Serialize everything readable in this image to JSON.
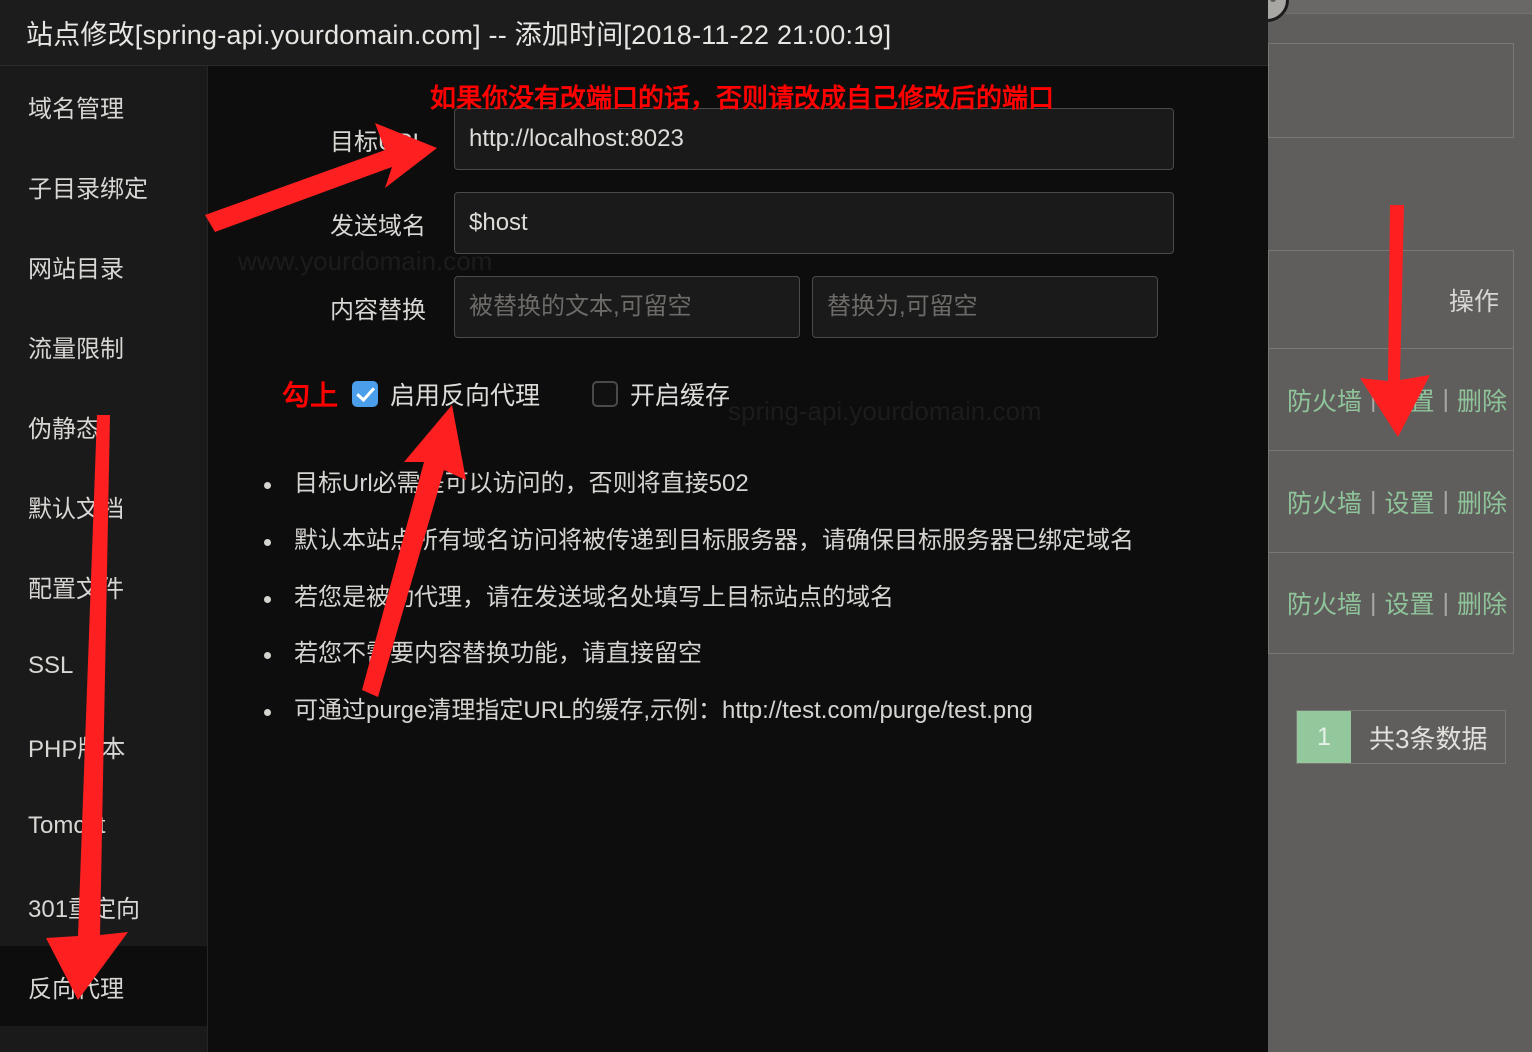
{
  "modal": {
    "title": "站点修改[spring-api.yourdomain.com] -- 添加时间[2018-11-22 21:00:19]"
  },
  "sidebar": {
    "items": [
      {
        "label": "域名管理",
        "active": false
      },
      {
        "label": "子目录绑定",
        "active": false
      },
      {
        "label": "网站目录",
        "active": false
      },
      {
        "label": "流量限制",
        "active": false
      },
      {
        "label": "伪静态",
        "active": false
      },
      {
        "label": "默认文档",
        "active": false
      },
      {
        "label": "配置文件",
        "active": false
      },
      {
        "label": "SSL",
        "active": false
      },
      {
        "label": "PHP版本",
        "active": false
      },
      {
        "label": "Tomcat",
        "active": false
      },
      {
        "label": "301重定向",
        "active": false
      },
      {
        "label": "反向代理",
        "active": true
      }
    ]
  },
  "annotations": {
    "top_note": "如果你没有改端口的话，否则请改成自己修改后的端口",
    "check_note": "勾上",
    "accent_color": "#fe0000"
  },
  "form": {
    "target_url": {
      "label": "目标URL",
      "value": "http://localhost:8023",
      "placeholder": ""
    },
    "send_host": {
      "label": "发送域名",
      "value": "$host",
      "placeholder": ""
    },
    "content_replace": {
      "label": "内容替换",
      "from_value": "",
      "from_placeholder": "被替换的文本,可留空",
      "to_value": "",
      "to_placeholder": "替换为,可留空"
    },
    "checkboxes": [
      {
        "label": "启用反向代理",
        "checked": true
      },
      {
        "label": "开启缓存",
        "checked": false
      }
    ]
  },
  "notes": [
    "目标Url必需是可以访问的，否则将直接502",
    "默认本站点所有域名访问将被传递到目标服务器，请确保目标服务器已绑定域名",
    "若您是被动代理，请在发送域名处填写上目标站点的域名",
    "若您不需要内容替换功能，请直接留空",
    "可通过purge清理指定URL的缓存,示例：http://test.com/purge/test.png"
  ],
  "background_table": {
    "header": "操作",
    "rows": [
      {
        "firewall": "防火墙",
        "settings": "设置",
        "delete": "删除",
        "sep": "|"
      },
      {
        "firewall": "防火墙",
        "settings": "设置",
        "delete": "删除",
        "sep": "|"
      },
      {
        "firewall": "防火墙",
        "settings": "设置",
        "delete": "删除",
        "sep": "|"
      }
    ],
    "pagination": {
      "current_page": "1",
      "total_text": "共3条数据"
    }
  }
}
